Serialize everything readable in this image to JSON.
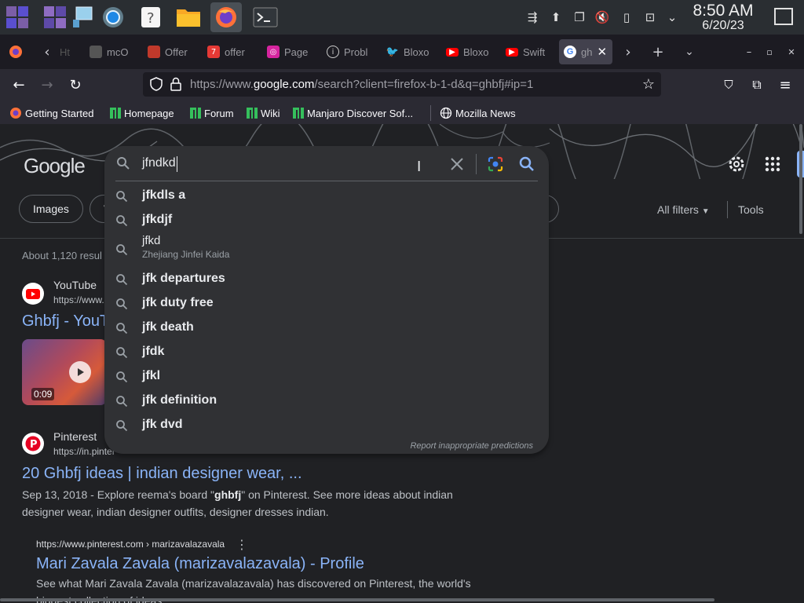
{
  "taskbar": {
    "apps": [
      {
        "name": "app-launcher"
      },
      {
        "name": "workspace-switcher"
      },
      {
        "name": "file-window"
      },
      {
        "name": "settings"
      },
      {
        "name": "help"
      },
      {
        "name": "files"
      },
      {
        "name": "firefox"
      },
      {
        "name": "terminal"
      }
    ],
    "clock_time": "8:50 AM",
    "clock_date": "6/20/23"
  },
  "tabs": [
    {
      "label": "Ht",
      "icon": "page-icon"
    },
    {
      "label": "mcO",
      "icon": "page-icon"
    },
    {
      "label": "Offer",
      "icon": "offer-icon"
    },
    {
      "label": "offer",
      "icon": "seven-icon"
    },
    {
      "label": "Page",
      "icon": "instagram-icon"
    },
    {
      "label": "Probl",
      "icon": "info-icon"
    },
    {
      "label": "Bloxo",
      "icon": "twitter-icon"
    },
    {
      "label": "Bloxo",
      "icon": "youtube-icon"
    },
    {
      "label": "Swift",
      "icon": "youtube-icon"
    },
    {
      "label": "gh",
      "icon": "google-icon",
      "active": true
    }
  ],
  "navbar": {
    "url_prefix": "https://www.",
    "url_domain": "google.com",
    "url_rest": "/search?client=firefox-b-1-d&q=ghbfj#ip=1"
  },
  "bookmarks": [
    {
      "label": "Getting Started",
      "icon": "firefox-icon"
    },
    {
      "label": "Homepage",
      "icon": "manjaro-icon"
    },
    {
      "label": "Forum",
      "icon": "manjaro-icon"
    },
    {
      "label": "Wiki",
      "icon": "manjaro-icon"
    },
    {
      "label": "Manjaro Discover Sof...",
      "icon": "manjaro-icon"
    },
    {
      "label": "Mozilla News",
      "icon": "globe-icon"
    }
  ],
  "google": {
    "logo": "Google",
    "chips": [
      "Images",
      "V"
    ],
    "all_filters": "All filters",
    "tools": "Tools",
    "results_count": "About 1,120 resul",
    "results": [
      {
        "site": "YouTube",
        "url": "https://www.",
        "title": "Ghbfj - YouT",
        "duration": "0:09"
      },
      {
        "site": "Pinterest",
        "url": "https://in.pinter",
        "title": "20 Ghbfj ideas | indian designer wear, ...",
        "snippet_pre": "Sep 13, 2018 - Explore reema's board \"",
        "snippet_bold": "ghbfj",
        "snippet_post": "\" on Pinterest. See more ideas about indian",
        "snippet_line2": "designer wear, indian designer outfits, designer dresses indian."
      },
      {
        "url": "https://www.pinterest.com › marizavalazavala",
        "title": "Mari Zavala Zavala (marizavalazavala) - Profile",
        "snippet_line1": "See what Mari Zavala Zavala (marizavalazavala) has discovered on Pinterest, the world's",
        "snippet_line2": "biggest collection of ideas."
      }
    ]
  },
  "search": {
    "query": "jfndkd",
    "suggestions": [
      {
        "text": "jfkdls a"
      },
      {
        "text": "jfkdjf"
      },
      {
        "text": "jfkd",
        "sub": "Zhejiang Jinfei Kaida"
      },
      {
        "text": "jfk departures"
      },
      {
        "text": "jfk duty free"
      },
      {
        "text": "jfk death"
      },
      {
        "text": "jfdk"
      },
      {
        "text": "jfkl"
      },
      {
        "text": "jfk definition"
      },
      {
        "text": "jfk dvd"
      }
    ],
    "report": "Report inappropriate predictions"
  }
}
